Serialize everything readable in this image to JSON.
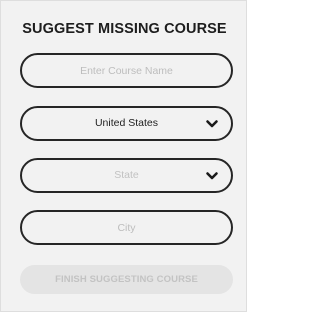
{
  "form": {
    "title": "SUGGEST MISSING COURSE",
    "course_name": {
      "value": "",
      "placeholder": "Enter Course Name"
    },
    "country": {
      "selected": "United States",
      "icon": "chevron-down-icon"
    },
    "state": {
      "placeholder": "State",
      "icon": "chevron-down-icon"
    },
    "city": {
      "value": "",
      "placeholder": "City"
    },
    "submit_label": "FINISH SUGGESTING COURSE"
  },
  "colors": {
    "background": "#f2f2f2",
    "border": "#262626",
    "placeholder_text": "#c2c2c2",
    "disabled_button_bg": "#e4e4e4",
    "disabled_button_text": "#c3c3c3"
  }
}
